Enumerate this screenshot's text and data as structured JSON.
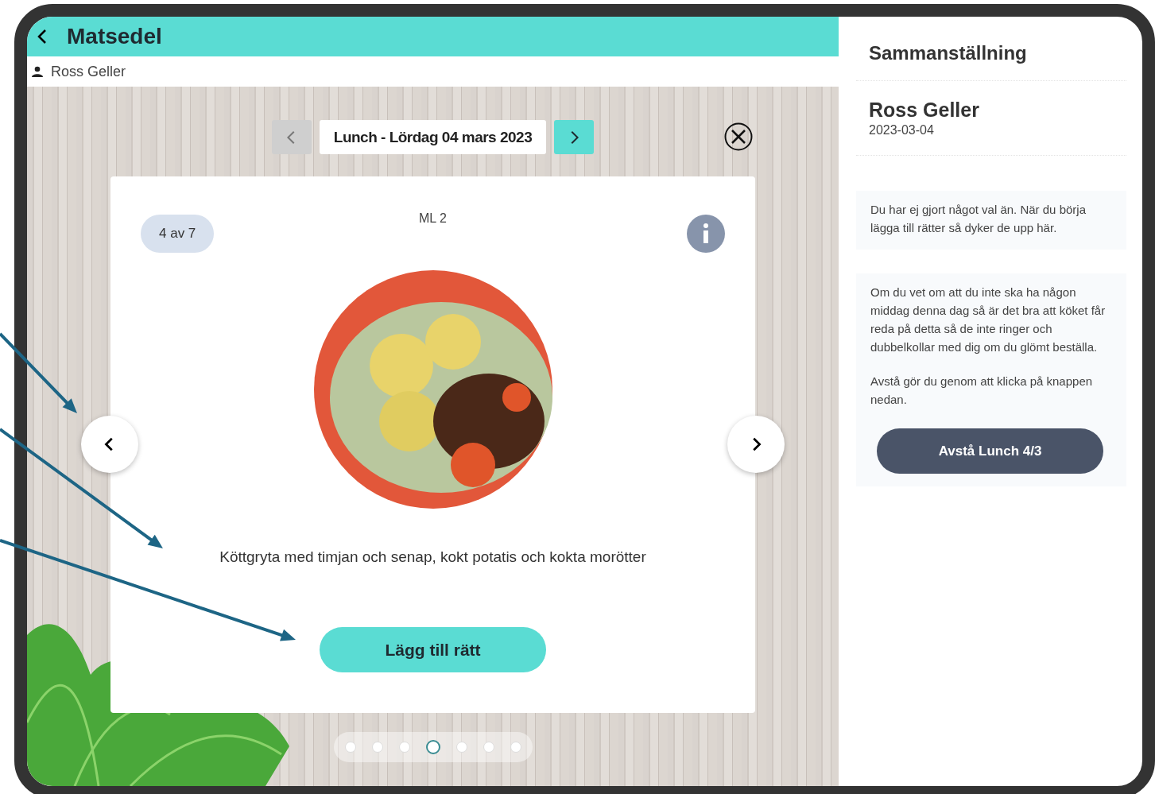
{
  "header": {
    "title": "Matsedel"
  },
  "user": {
    "name": "Ross Geller"
  },
  "meal_nav": {
    "label": "Lunch - Lördag 04 mars 2023",
    "prev_disabled": true,
    "next_disabled": false
  },
  "dish": {
    "counter": "4 av 7",
    "code": "ML 2",
    "description": "Köttgryta med timjan och senap, kokt potatis och kokta morötter",
    "add_button": "Lägg till rätt"
  },
  "pager": [
    {
      "selected": false
    },
    {
      "selected": false
    },
    {
      "selected": false
    },
    {
      "selected": true
    },
    {
      "selected": false
    },
    {
      "selected": false
    },
    {
      "selected": false
    }
  ],
  "summary": {
    "title": "Sammanställning",
    "name": "Ross Geller",
    "date": "2023-03-04",
    "empty_note": "Du har ej gjort något val än. När du börja lägga till rätter så dyker de upp här.",
    "skip_paragraphs": [
      "Om du vet om att du inte ska ha någon middag denna dag så är det bra att köket får reda på detta så de inte ringer och dubbelkollar med dig om du glömt beställa.",
      "Avstå gör du genom att klicka på knappen nedan."
    ],
    "skip_button": "Avstå Lunch 4/3"
  }
}
